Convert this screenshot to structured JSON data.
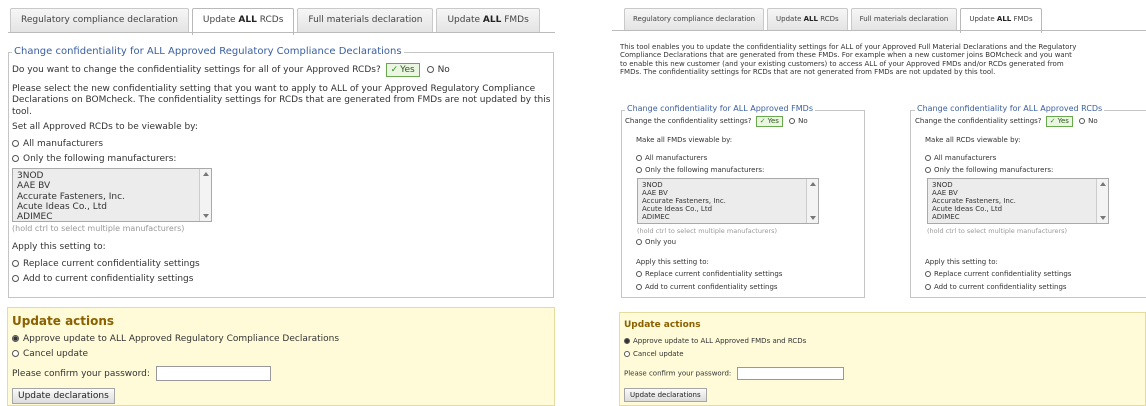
{
  "left": {
    "tabs": [
      "Regulatory compliance declaration",
      "Update ",
      "Full materials declaration",
      "Update "
    ],
    "tabs_bold": [
      "",
      "ALL",
      "",
      "ALL"
    ],
    "tabs_suffix": [
      "",
      " RCDs",
      "",
      " FMDs"
    ],
    "legend": "Change confidentiality for ALL Approved Regulatory Compliance Declarations",
    "question": "Do you want to change the confidentiality settings for all of your Approved RCDs?",
    "yes": "Yes",
    "no": "No",
    "info_1": "Please select the new confidentiality setting that you want to apply to ALL of your Approved Regulatory Compliance",
    "info_2": "Declarations on BOMcheck. The confidentiality settings for RCDs that are generated from FMDs are not updated by this",
    "info_3": "tool.",
    "set_label": "Set all Approved RCDs to be viewable by:",
    "opt_all": "All manufacturers",
    "opt_only": "Only the following manufacturers:",
    "manufacturers": [
      "3NOD",
      "AAE BV",
      "Accurate Fasteners, Inc.",
      "Acute Ideas Co., Ltd",
      "ADIMEC"
    ],
    "hint": "(hold ctrl to select multiple manufacturers)",
    "apply_label": "Apply this setting to:",
    "apply_replace": "Replace current confidentiality settings",
    "apply_add": "Add to current confidentiality settings",
    "actions_title": "Update actions",
    "approve": "Approve update to ALL Approved Regulatory Compliance Declarations",
    "cancel": "Cancel update",
    "password_label": "Please confirm your password:",
    "update_btn": "Update declarations"
  },
  "right": {
    "tabs": [
      "Regulatory compliance declaration",
      "Update ",
      "Full materials declaration",
      "Update "
    ],
    "tabs_bold": [
      "",
      "ALL",
      "",
      "ALL"
    ],
    "tabs_suffix": [
      "",
      " RCDs",
      "",
      " FMDs"
    ],
    "intro_1": "This tool enables you to update the confidentiality settings for ALL of your Approved Full Material Declarations and the Regulatory",
    "intro_2": "Compliance Declarations that are generated from these FMDs. For example when a new customer joins BOMcheck and you want",
    "intro_3": "to enable this new customer (and your existing customers) to access ALL of your Approved FMDs and/or RCDs generated from",
    "intro_4": "FMDs. The confidentiality settings for RCDs that are not generated from FMDs are not updated by this tool.",
    "fmd": {
      "legend": "Change confidentiality for ALL Approved FMDs",
      "question": "Change the confidentiality settings?",
      "yes": "Yes",
      "no": "No",
      "make_label": "Make all FMDs viewable by:",
      "opt_all": "All manufacturers",
      "opt_only": "Only the following manufacturers:",
      "manufacturers": [
        "3NOD",
        "AAE BV",
        "Accurate Fasteners, Inc.",
        "Acute Ideas Co., Ltd",
        "ADIMEC"
      ],
      "hint": "(hold ctrl to select multiple manufacturers)",
      "opt_you": "Only you",
      "apply_label": "Apply this setting to:",
      "apply_replace": "Replace current confidentiality settings",
      "apply_add": "Add to current confidentiality settings"
    },
    "rcd": {
      "legend": "Change confidentiality for ALL Approved RCDs",
      "question": "Change the confidentiality settings?",
      "yes": "Yes",
      "no": "No",
      "make_label": "Make all RCDs viewable by:",
      "opt_all": "All manufacturers",
      "opt_only": "Only the following manufacturers:",
      "manufacturers": [
        "3NOD",
        "AAE BV",
        "Accurate Fasteners, Inc.",
        "Acute Ideas Co., Ltd",
        "ADIMEC"
      ],
      "hint": "(hold ctrl to select multiple manufacturers)",
      "apply_label": "Apply this setting to:",
      "apply_replace": "Replace current confidentiality settings",
      "apply_add": "Add to current confidentiality settings"
    },
    "actions_title": "Update actions",
    "approve": "Approve update to ALL Approved FMDs and RCDs",
    "cancel": "Cancel update",
    "password_label": "Please confirm your password:",
    "update_btn": "Update declarations"
  },
  "colors": {
    "legend": "#3a5f9f",
    "actions_bg": "#fffbd9",
    "actions_title": "#8a6000",
    "yes_border": "#6aa84f"
  }
}
